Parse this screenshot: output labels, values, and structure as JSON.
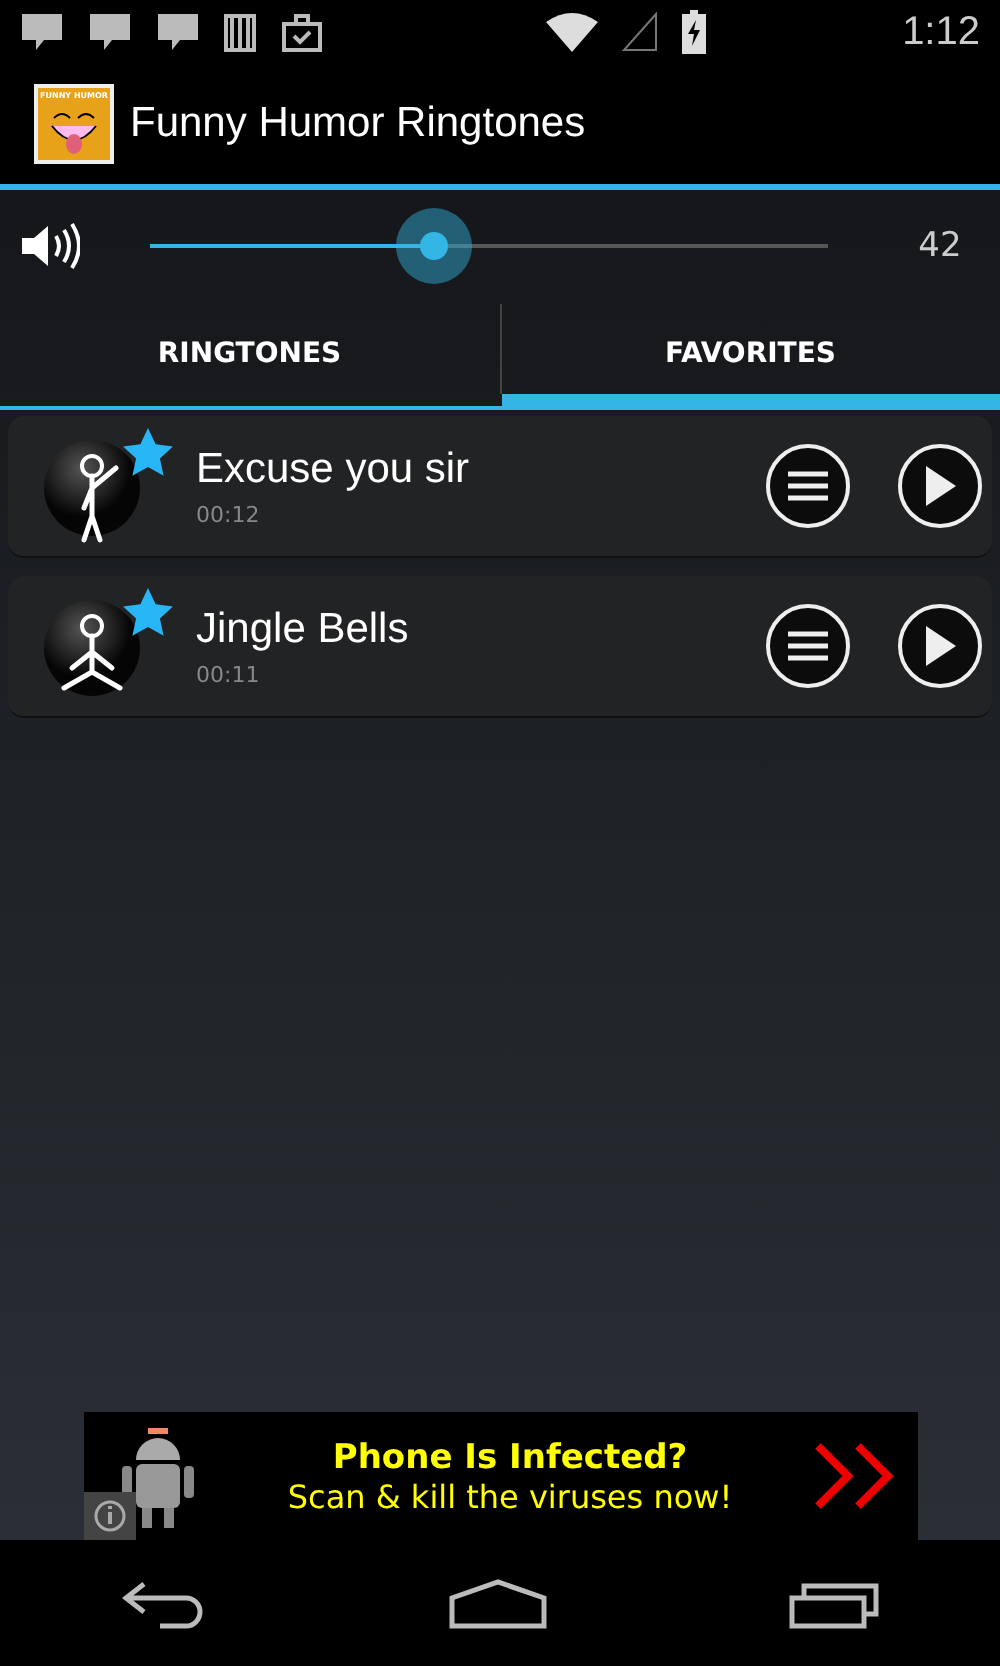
{
  "status_bar": {
    "time": "1:12"
  },
  "app_bar": {
    "icon_text": "FUNNY HUMOR",
    "title": "Funny Humor Ringtones"
  },
  "volume": {
    "level": 0.42,
    "reading": "42"
  },
  "tabs": [
    {
      "label": "RINGTONES",
      "selected": false
    },
    {
      "label": "FAVORITES",
      "selected": true
    }
  ],
  "ringtones": [
    {
      "title": "Excuse you sir",
      "duration": "00:12",
      "favorite": true,
      "kind": "wave"
    },
    {
      "title": "Jingle Bells",
      "duration": "00:11",
      "favorite": true,
      "kind": "sit"
    }
  ],
  "ad": {
    "headline": "Phone Is Infected?",
    "text": "Scan & kill the viruses now!"
  }
}
